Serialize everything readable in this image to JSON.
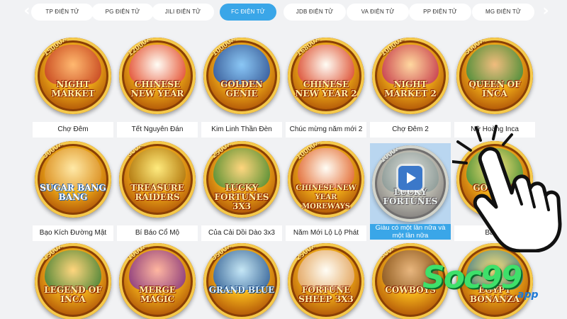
{
  "nav": {
    "prev_icon": "chevron-left-icon",
    "next_icon": "chevron-right-icon",
    "prev_glyph": "‹",
    "next_glyph": "›",
    "active_tab": "FC ĐIỆN TỬ",
    "tabs": [
      "TP ĐIỆN TỬ",
      "PG ĐIỆN TỬ",
      "JILI ĐIỆN TỬ",
      "FC ĐIỆN TỬ",
      "JDB ĐIỆN TỬ",
      "VA ĐIỆN TỬ",
      "PP ĐIỆN TỬ",
      "MG ĐIỆN TỬ"
    ]
  },
  "colors": {
    "background": "#f1f2f4",
    "active_tab": "#3aa6e8",
    "hover_label": "#3aa6e8",
    "watermark_green": "#3ee06a",
    "watermark_blue": "#1e7ad6"
  },
  "games": [
    {
      "name": "Chợ Đêm",
      "logo": "NIGHT MARKET",
      "mult": "15000X"
    },
    {
      "name": "Tết Nguyên Đán",
      "logo": "CHINESE NEW YEAR",
      "mult": "12000X"
    },
    {
      "name": "Kim Linh Thần Đèn",
      "logo": "GOLDEN GENIE",
      "mult": "10000X"
    },
    {
      "name": "Chúc mừng năm mới 2",
      "logo": "CHINESE NEW YEAR 2",
      "mult": "16800X"
    },
    {
      "name": "Chợ Đêm 2",
      "logo": "NIGHT MARKET 2",
      "mult": "10000X"
    },
    {
      "name": "Nữ Hoàng Inca",
      "logo": "QUEEN OF INCA",
      "mult": "5000X"
    },
    {
      "name": "Bạo Kích Đường Mật",
      "logo": "SUGAR BANG BANG",
      "mult": "3000X"
    },
    {
      "name": "Bí Báo Cổ Mộ",
      "logo": "TREASURE RAIDERS",
      "mult": "600X"
    },
    {
      "name": "Của Cải Dồi Dào 3x3",
      "logo": "LUCKY FORTUNES 3X3",
      "mult": "2500X"
    },
    {
      "name": "Năm Mới Lộ Lộ Phát",
      "logo": "CHINESE NEW YEAR MOREWAYS",
      "mult": "10000X"
    },
    {
      "name": "Giàu có một lần nữa và một lần nữa",
      "logo": "LUCKY FORTUNES",
      "mult": "1000X"
    },
    {
      "name": "Bảo V",
      "logo": "GOLD PA",
      "mult": ""
    },
    {
      "name": "",
      "logo": "LEGEND OF INCA",
      "mult": "1500X"
    },
    {
      "name": "",
      "logo": "MERGE MAGIC",
      "mult": "1000X"
    },
    {
      "name": "",
      "logo": "GRAND BLUE",
      "mult": "3500X"
    },
    {
      "name": "",
      "logo": "FORTUNE SHEEP 3X3",
      "mult": "2500X"
    },
    {
      "name": "",
      "logo": "COWBOYS",
      "mult": "300X"
    },
    {
      "name": "",
      "logo": "EGYPT BONANZA",
      "mult": ""
    }
  ],
  "highlighted_game": "Giàu có một lần nữa và một lần nữa",
  "overlay": {
    "hand_icon": "pointing-hand-cursor-icon",
    "watermark_text": "Soc99",
    "watermark_sub": "app"
  }
}
